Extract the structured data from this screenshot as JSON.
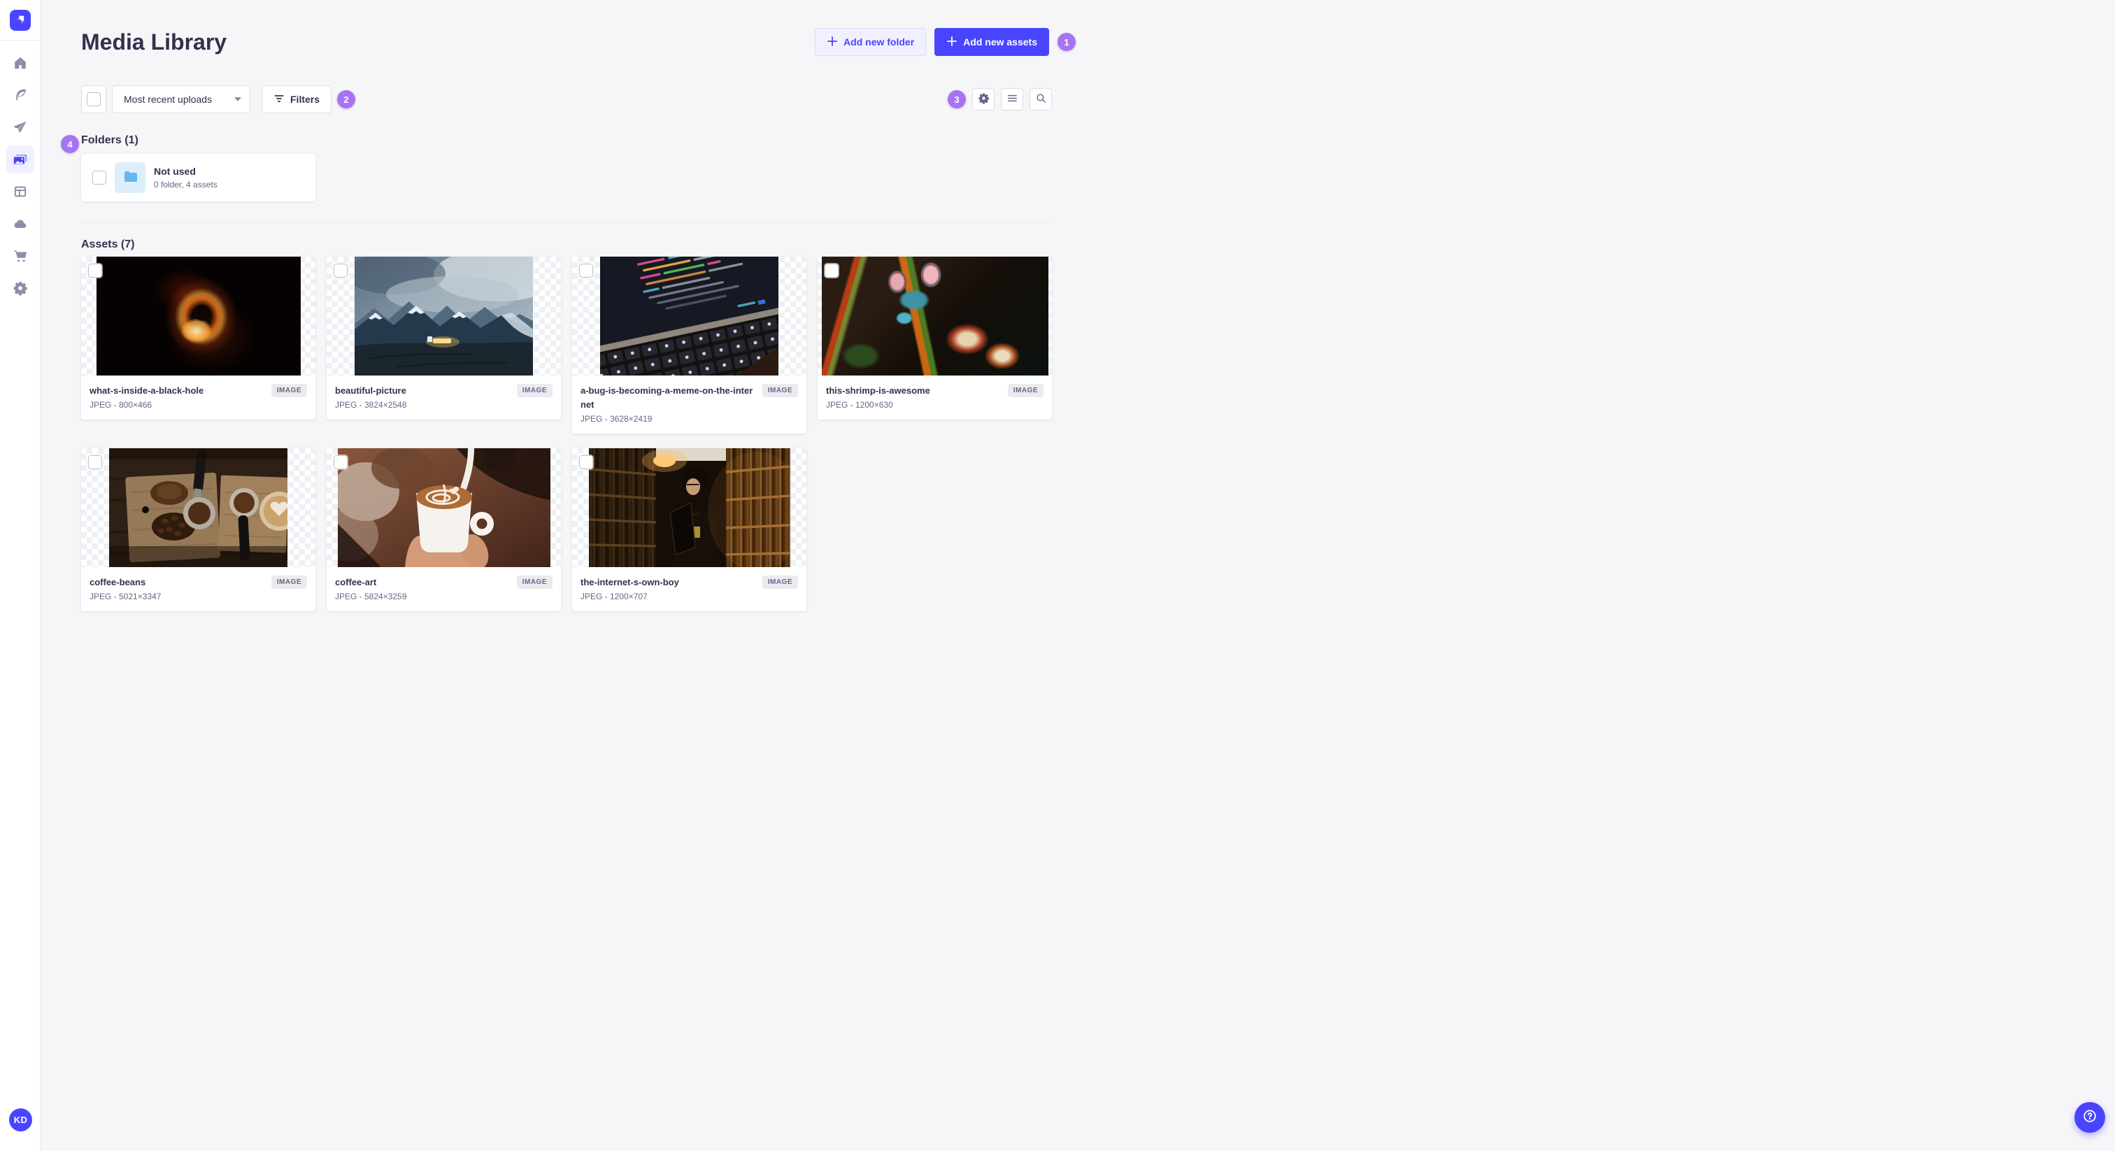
{
  "colors": {
    "primary": "#4945ff",
    "annotation_badge": "#a673f2",
    "text_heading": "#32324d",
    "text_muted": "#666687",
    "background": "#f6f6f9"
  },
  "sidebar": {
    "logo_icon": "strapi-logo",
    "nav_icons": [
      "home-icon",
      "feather-icon",
      "paper-plane-icon",
      "images-icon-active",
      "layout-icon",
      "cloud-icon",
      "cart-icon",
      "gear-icon"
    ],
    "user_initials": "KD"
  },
  "header": {
    "title": "Media Library",
    "add_folder_label": "Add new folder",
    "add_assets_label": "Add new assets"
  },
  "toolbar": {
    "sort_value": "Most recent uploads",
    "filters_label": "Filters",
    "right_icons": [
      "settings-gear-icon",
      "list-view-icon",
      "search-icon"
    ]
  },
  "annotations": {
    "n1": "1",
    "n2": "2",
    "n3": "3",
    "n4": "4"
  },
  "folders": {
    "heading": "Folders (1)",
    "items": [
      {
        "title": "Not used",
        "subtitle": "0 folder, 4 assets",
        "icon": "folder-icon"
      }
    ]
  },
  "assets": {
    "heading": "Assets (7)",
    "items": [
      {
        "title": "what-s-inside-a-black-hole",
        "meta": "JPEG - 800×466",
        "badge": "IMAGE"
      },
      {
        "title": "beautiful-picture",
        "meta": "JPEG - 3824×2548",
        "badge": "IMAGE"
      },
      {
        "title": "a-bug-is-becoming-a-meme-on-the-internet",
        "meta": "JPEG - 3628×2419",
        "badge": "IMAGE"
      },
      {
        "title": "this-shrimp-is-awesome",
        "meta": "JPEG - 1200×630",
        "badge": "IMAGE"
      },
      {
        "title": "coffee-beans",
        "meta": "JPEG - 5021×3347",
        "badge": "IMAGE"
      },
      {
        "title": "coffee-art",
        "meta": "JPEG - 5824×3259",
        "badge": "IMAGE"
      },
      {
        "title": "the-internet-s-own-boy",
        "meta": "JPEG - 1200×707",
        "badge": "IMAGE"
      }
    ]
  },
  "help": {
    "icon": "question-mark-icon"
  }
}
